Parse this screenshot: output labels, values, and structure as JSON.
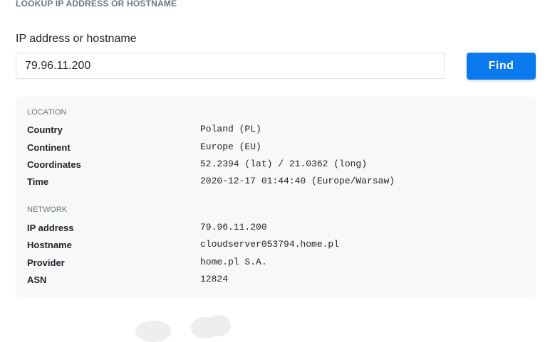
{
  "section_heading": "LOOKUP IP ADDRESS OR HOSTNAME",
  "field_label": "IP address or hostname",
  "search": {
    "value": "79.96.11.200"
  },
  "find_button": "Find",
  "location": {
    "heading": "LOCATION",
    "rows": [
      {
        "key": "Country",
        "value": "Poland (PL)"
      },
      {
        "key": "Continent",
        "value": "Europe (EU)"
      },
      {
        "key": "Coordinates",
        "value": "52.2394 (lat) / 21.0362 (long)"
      },
      {
        "key": "Time",
        "value": "2020-12-17 01:44:40 (Europe/Warsaw)"
      }
    ]
  },
  "network": {
    "heading": "NETWORK",
    "rows": [
      {
        "key": "IP address",
        "value": "79.96.11.200"
      },
      {
        "key": "Hostname",
        "value": "cloudserver053794.home.pl"
      },
      {
        "key": "Provider",
        "value": "home.pl S.A."
      },
      {
        "key": "ASN",
        "value": "12824"
      }
    ]
  }
}
